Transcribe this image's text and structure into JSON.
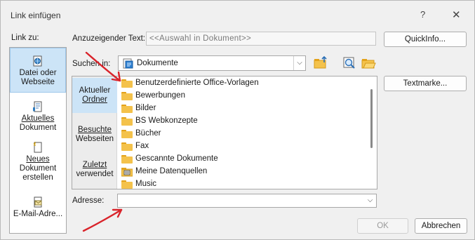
{
  "dialog": {
    "title": "Link einfügen",
    "help": "?",
    "close": "✕"
  },
  "link_to": {
    "label": "Link zu:",
    "items": [
      {
        "line1": "Datei oder",
        "line2": "Webseite"
      },
      {
        "line1": "Aktuelles",
        "line2": "Dokument"
      },
      {
        "line1": "Neues",
        "line2": "Dokument",
        "line3": "erstellen"
      },
      {
        "line1": "E-Mail-Adre..."
      }
    ]
  },
  "display_text": {
    "label": "Anzuzeigender Text:",
    "value": "<<Auswahl in Dokument>>"
  },
  "quickinfo_label": "QuickInfo...",
  "look_in": {
    "label": "Suchen in:",
    "value": "Dokumente"
  },
  "locations": [
    {
      "line1": "Aktueller",
      "line2": "Ordner"
    },
    {
      "line1": "Besuchte",
      "line2": "Webseiten"
    },
    {
      "line1": "Zuletzt",
      "line2": "verwendet"
    }
  ],
  "files": [
    "Benutzerdefinierte Office-Vorlagen",
    "Bewerbungen",
    "Bilder",
    "BS Webkonzepte",
    "Bücher",
    "Fax",
    "Gescannte Dokumente",
    "Meine Datenquellen",
    "Music"
  ],
  "bookmark_label": "Textmarke...",
  "address": {
    "label": "Adresse:",
    "value": ""
  },
  "buttons": {
    "ok": "OK",
    "cancel": "Abbrechen"
  },
  "colors": {
    "accent_selected": "#cce4f7",
    "annotation_arrow": "#d9232a",
    "folder": "#f4c24b"
  }
}
